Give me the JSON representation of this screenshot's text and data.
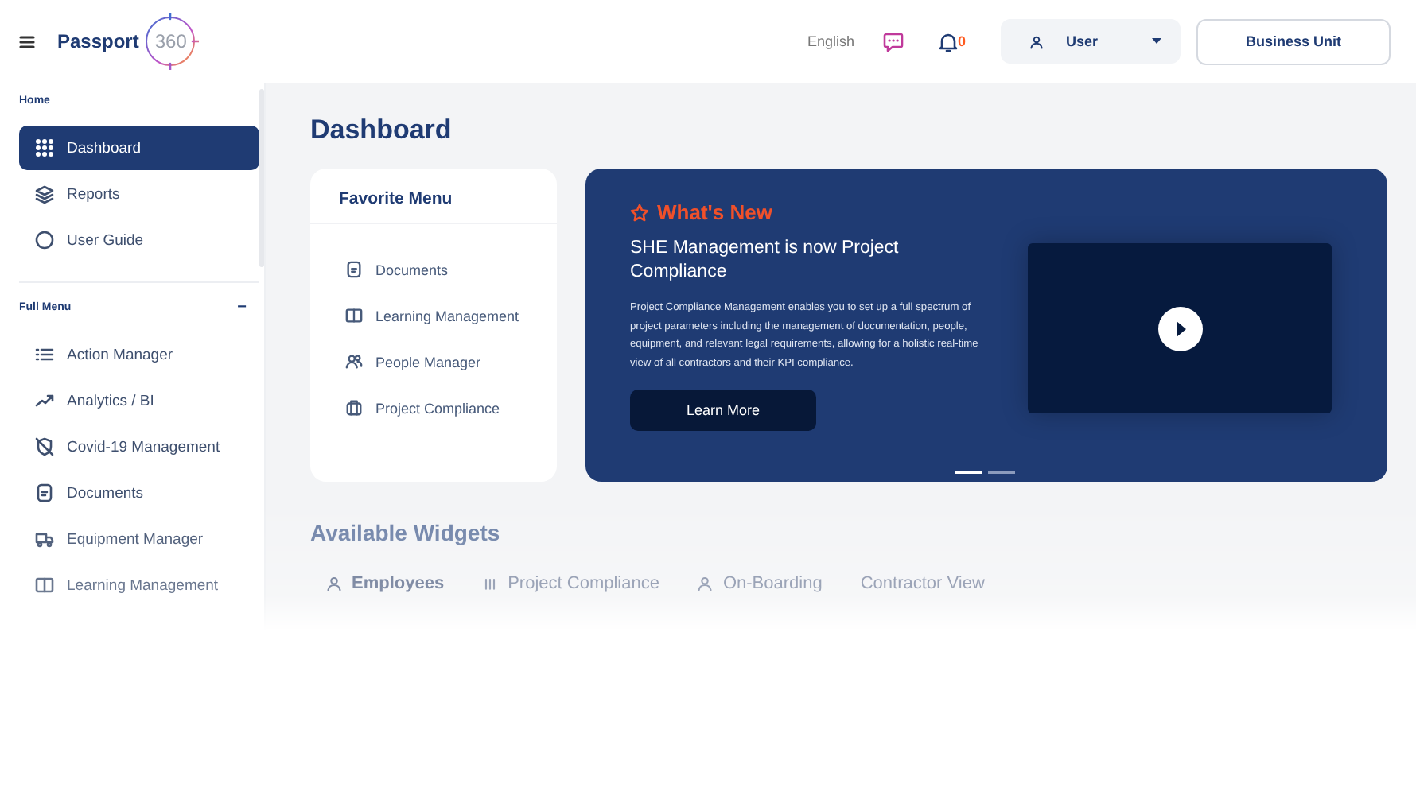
{
  "header": {
    "logo": {
      "name": "Passport",
      "number": "360"
    },
    "language": "English",
    "notifications": "0",
    "user": "User",
    "business_unit": "Business Unit"
  },
  "sidebar": {
    "sections": [
      {
        "title": "Home",
        "items": [
          {
            "label": "Dashboard",
            "selected": true
          },
          {
            "label": "Reports",
            "selected": false
          },
          {
            "label": "User Guide",
            "selected": false
          }
        ]
      },
      {
        "title": "Full Menu",
        "toggle": "−",
        "items": [
          {
            "label": "Action Manager",
            "selected": false
          },
          {
            "label": "Analytics / BI",
            "selected": false
          },
          {
            "label": "Covid-19 Management",
            "selected": false
          },
          {
            "label": "Documents",
            "selected": false
          },
          {
            "label": "Equipment Manager",
            "selected": false
          },
          {
            "label": "Learning Management",
            "selected": false
          }
        ]
      }
    ]
  },
  "page_title": "Dashboard",
  "favorite_menu": {
    "title": "Favorite Menu",
    "items": [
      "Documents",
      "Learning Management",
      "People Manager",
      "Project Compliance"
    ]
  },
  "whats_new": {
    "title": "What's New",
    "headline": "SHE Management is now Project Compliance",
    "body": "Project Compliance Management enables you to set up a full spectrum of project parameters including the management of documentation, people, equipment, and relevant legal requirements, allowing for a holistic real-time view of all contractors and their KPI compliance.",
    "button": "Learn More",
    "slides": [
      {
        "selected": true
      },
      {
        "selected": false
      }
    ]
  },
  "widgets": {
    "title": "Available Widgets",
    "tabs": [
      {
        "label": "Employees",
        "selected": true
      },
      {
        "label": "Project Compliance",
        "selected": false
      },
      {
        "label": "On-Boarding",
        "selected": false
      },
      {
        "label": "Contractor View",
        "selected": false
      }
    ]
  }
}
